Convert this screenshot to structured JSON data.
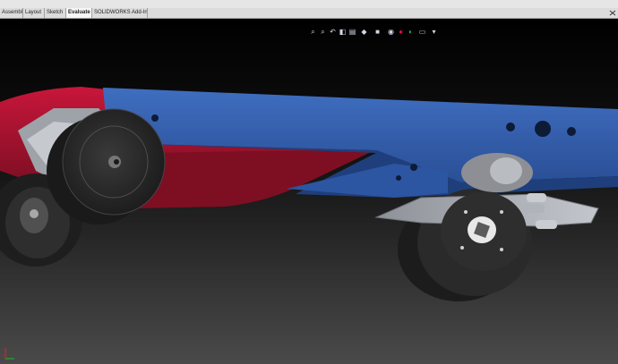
{
  "window": {
    "minimize_icon": "minimize-icon",
    "restore_icon": "restore-icon",
    "close_icon": "close-icon"
  },
  "command_tabs": [
    {
      "label": "Assembly",
      "active": false
    },
    {
      "label": "Layout",
      "active": false
    },
    {
      "label": "Sketch",
      "active": false
    },
    {
      "label": "Evaluate",
      "active": true
    },
    {
      "label": "SOLIDWORKS Add-Ins",
      "active": false
    }
  ],
  "view_toolbar": {
    "icons": [
      "zoom-to-fit-icon",
      "zoom-to-area-icon",
      "previous-view-icon",
      "section-view-icon",
      "dynamic-annotation-icon",
      "view-orientation-icon",
      "display-style-icon",
      "hide-show-items-icon",
      "edit-appearance-icon",
      "apply-scene-icon",
      "view-settings-icon",
      "display-pane-icon"
    ]
  },
  "colors": {
    "viewport_top": "#000000",
    "viewport_bottom": "#4a4a4a",
    "frame_blue": "#2f5aa8",
    "frame_red": "#b3102a",
    "wheel_dark": "#2b2b2b",
    "bracket_grey": "#a9acb2"
  },
  "triad": {
    "icon": "coordinate-triad-icon"
  }
}
